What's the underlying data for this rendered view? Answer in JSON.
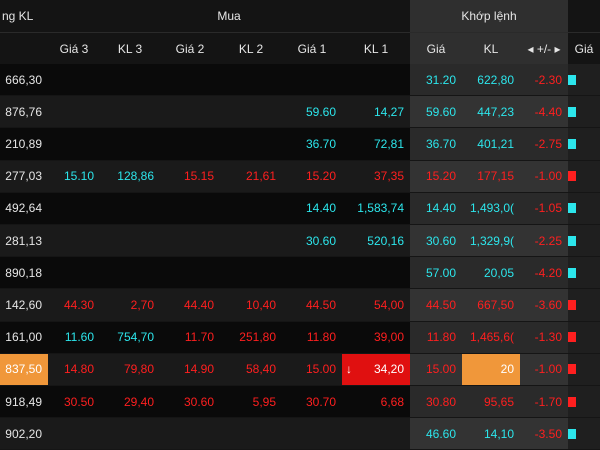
{
  "colors": {
    "up": "#2ce6ec",
    "down": "#ff1f1f",
    "ref": "#f2e52c",
    "text": "#e6e6e6",
    "header_bg": "#141414",
    "header_bg_match": "#2f2f2f",
    "row_dark": "#0a0a0a",
    "row_light": "#1a1a1a",
    "match_col_bg": "#2b2b2b",
    "highlight_orange": "#f0973a",
    "highlight_red": "#e01010"
  },
  "header": {
    "partial_label": "ng KL",
    "buy_group": "Mua",
    "match_group": "Khớp lệnh"
  },
  "columns": [
    {
      "key": "total",
      "label": ""
    },
    {
      "key": "p3",
      "label": "Giá 3"
    },
    {
      "key": "v3",
      "label": "KL 3"
    },
    {
      "key": "p2",
      "label": "Giá 2"
    },
    {
      "key": "v2",
      "label": "KL 2"
    },
    {
      "key": "p1",
      "label": "Giá 1"
    },
    {
      "key": "v1",
      "label": "KL 1"
    },
    {
      "key": "mp",
      "label": "Giá"
    },
    {
      "key": "mv",
      "label": "KL"
    },
    {
      "key": "chg",
      "label": "◂ +/- ▸"
    },
    {
      "key": "next",
      "label": "Giá"
    }
  ],
  "rows": [
    {
      "total": "666,30",
      "p3": "",
      "v3": "",
      "p2": "",
      "v2": "",
      "p1": "",
      "v1": "",
      "mp": "31.20",
      "mv": "622,80",
      "chg": "-2.30",
      "trend": "up"
    },
    {
      "total": "876,76",
      "p3": "",
      "v3": "",
      "p2": "",
      "v2": "",
      "p1": "59.60",
      "v1": "14,27",
      "mp": "59.60",
      "mv": "447,23",
      "chg": "-4.40",
      "trend": "up"
    },
    {
      "total": "210,89",
      "p3": "",
      "v3": "",
      "p2": "",
      "v2": "",
      "p1": "36.70",
      "v1": "72,81",
      "mp": "36.70",
      "mv": "401,21",
      "chg": "-2.75",
      "trend": "up"
    },
    {
      "total": "277,03",
      "p3": "15.10",
      "v3": "128,86",
      "p2": "15.15",
      "v2": "21,61",
      "p1": "15.20",
      "v1": "37,35",
      "mp": "15.20",
      "mv": "177,15",
      "chg": "-1.00",
      "trend": "down",
      "p3_trend": "up",
      "v3_trend": "up"
    },
    {
      "total": "492,64",
      "p3": "",
      "v3": "",
      "p2": "",
      "v2": "",
      "p1": "14.40",
      "v1": "1,583,74",
      "mp": "14.40",
      "mv": "1,493,0(",
      "chg": "-1.05",
      "trend": "up"
    },
    {
      "total": "281,13",
      "p3": "",
      "v3": "",
      "p2": "",
      "v2": "",
      "p1": "30.60",
      "v1": "520,16",
      "mp": "30.60",
      "mv": "1,329,9(",
      "chg": "-2.25",
      "trend": "up"
    },
    {
      "total": "890,18",
      "p3": "",
      "v3": "",
      "p2": "",
      "v2": "",
      "p1": "",
      "v1": "",
      "mp": "57.00",
      "mv": "20,05",
      "chg": "-4.20",
      "trend": "up"
    },
    {
      "total": "142,60",
      "p3": "44.30",
      "v3": "2,70",
      "p2": "44.40",
      "v2": "10,40",
      "p1": "44.50",
      "v1": "54,00",
      "mp": "44.50",
      "mv": "667,50",
      "chg": "-3.60",
      "trend": "down"
    },
    {
      "total": "161,00",
      "p3": "11.60",
      "v3": "754,70",
      "p2": "11.70",
      "v2": "251,80",
      "p1": "11.80",
      "v1": "39,00",
      "mp": "11.80",
      "mv": "1,465,6(",
      "chg": "-1.30",
      "trend": "down",
      "p3_trend": "up",
      "v3_trend": "up"
    },
    {
      "total": "837,50",
      "p3": "14.80",
      "v3": "79,80",
      "p2": "14.90",
      "v2": "58,40",
      "p1": "15.00",
      "v1": "34,20",
      "mp": "15.00",
      "mv": "20",
      "chg": "-1.00",
      "trend": "down",
      "highlight": true,
      "flash_arrow": "↓"
    },
    {
      "total": "918,49",
      "p3": "30.50",
      "v3": "29,40",
      "p2": "30.60",
      "v2": "5,95",
      "p1": "30.70",
      "v1": "6,68",
      "mp": "30.80",
      "mv": "95,65",
      "chg": "-1.70",
      "trend": "down"
    },
    {
      "total": "902,20",
      "p3": "",
      "v3": "",
      "p2": "",
      "v2": "",
      "p1": "",
      "v1": "",
      "mp": "46.60",
      "mv": "14,10",
      "chg": "-3.50",
      "trend": "up"
    }
  ]
}
